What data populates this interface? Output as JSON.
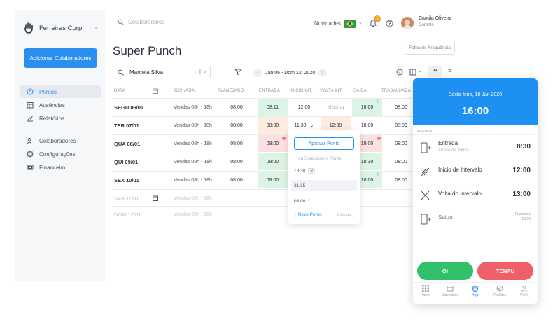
{
  "company": {
    "name": "Ferreiras Corp."
  },
  "sidebar": {
    "add_button": "Adicionar Colaboradores",
    "items": [
      {
        "label": "Pontos",
        "icon": "clock-icon"
      },
      {
        "label": "Ausências",
        "icon": "calendar-icon"
      },
      {
        "label": "Relatórios",
        "icon": "chart-icon"
      },
      {
        "label": "Colaboradores",
        "icon": "users-icon"
      },
      {
        "label": "Configurações",
        "icon": "gear-icon"
      },
      {
        "label": "Financeiro",
        "icon": "money-icon"
      }
    ]
  },
  "topbar": {
    "search_placeholder": "Colaboradores",
    "novidades": "Novidades",
    "notification_count": "5",
    "user_name": "Camila Oliveira",
    "user_role": "Gerente"
  },
  "page": {
    "title": "Super Punch",
    "folha_button": "Folha de Frequência",
    "employee": "Marcela Silva",
    "date_range": "Jan 06 - Dom 12, 2020"
  },
  "table": {
    "headers": [
      "DATA",
      "JORNADA",
      "PLANEJADO",
      "ENTRADA",
      "INICIO INT.",
      "VOLTA INT.",
      "SAIDA",
      "TRABALHADA"
    ],
    "rows": [
      {
        "date": "SEGU 06/01",
        "jornada": "Vendas 08h - 18h",
        "planejado": "08:00",
        "entrada": "08:11",
        "inicio": "12:00",
        "volta": "Missing",
        "saida": "18:00",
        "trab": "08:00"
      },
      {
        "date": "TER 07/01",
        "jornada": "Vendas 08h - 18h",
        "planejado": "08:00",
        "entrada": "08:00",
        "inicio": "11:30",
        "volta": "12:30",
        "saida": "18:00",
        "trab": "08:00"
      },
      {
        "date": "QUA 08/01",
        "jornada": "Vendas 08h - 18h",
        "planejado": "08:00",
        "entrada": "08:00",
        "inicio": "",
        "volta": "",
        "saida": "18:00",
        "trab": "08:00"
      },
      {
        "date": "QUI 09/01",
        "jornada": "Vendas 08h - 18h",
        "planejado": "08:00",
        "entrada": "08:00",
        "inicio": "",
        "volta": "",
        "saida": "18:30",
        "trab": "08:00"
      },
      {
        "date": "SEX 10/01",
        "jornada": "Vendas 08h - 18h",
        "planejado": "08:00",
        "entrada": "08:00",
        "inicio": "",
        "volta": "",
        "saida": "18:00",
        "trab": "08:00"
      },
      {
        "date": "SAB 11/01",
        "jornada": "Vendas 08h - 18h"
      },
      {
        "date": "DOM 12/01",
        "jornada": "Vendas 08h - 18h"
      }
    ]
  },
  "popover": {
    "aprovar": "Aprovar Ponto",
    "ou": "ou Selecione o Ponto",
    "opt1": "18:30",
    "opt1_badge": "M",
    "opt2": "21:35",
    "opt3": "03:00",
    "novo": "+ Novo Ponto",
    "limpar": "Limpar"
  },
  "mobile": {
    "date": "Sexta-feira, 10 Jan 2020",
    "time": "16:00",
    "agenda": "AGENDA",
    "items": [
      {
        "label": "Entrada",
        "sub": "Atraso de 30min",
        "time": "8:30"
      },
      {
        "label": "Inicio de Intervalo",
        "time": "12:00"
      },
      {
        "label": "Volta do Intervalo",
        "time": "13:00"
      },
      {
        "label": "Saida",
        "sub": "Planejado",
        "time": "18:00"
      }
    ],
    "oi": "OI",
    "tchau": "TCHAU",
    "tabs": [
      "Painel",
      "Calendario",
      "Hoje",
      "Pedidos",
      "Perfil"
    ]
  }
}
